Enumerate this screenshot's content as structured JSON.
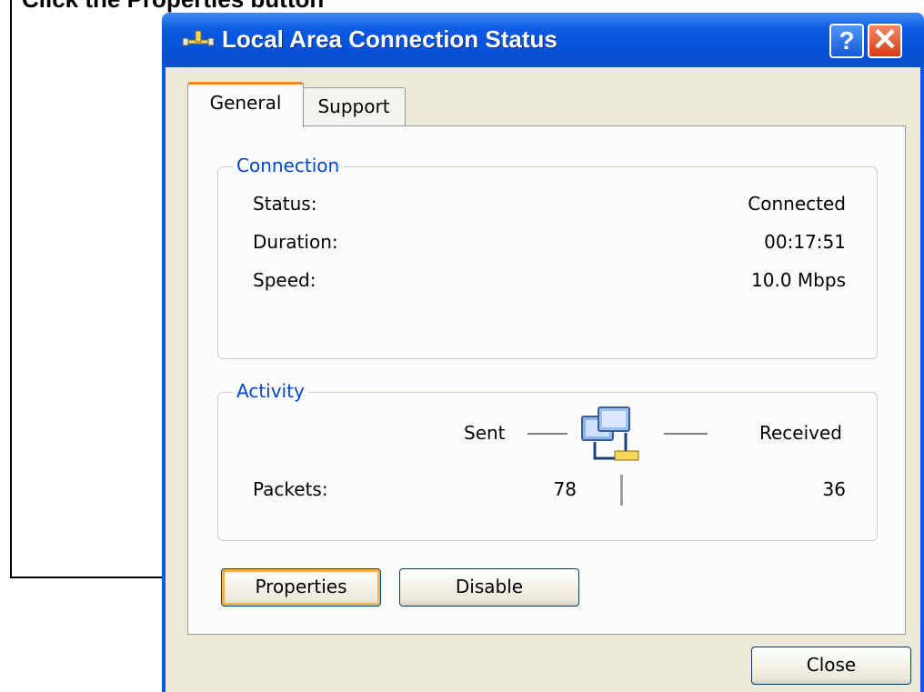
{
  "annotation": {
    "caption": "Click the Properties button"
  },
  "window": {
    "title": "Local Area Connection Status",
    "help_label": "?",
    "close_label": "✕"
  },
  "tabs": [
    {
      "label": "General"
    },
    {
      "label": "Support"
    }
  ],
  "connection": {
    "legend": "Connection",
    "rows": [
      {
        "label": "Status:",
        "value": "Connected"
      },
      {
        "label": "Duration:",
        "value": "00:17:51"
      },
      {
        "label": "Speed:",
        "value": "10.0 Mbps"
      }
    ]
  },
  "activity": {
    "legend": "Activity",
    "sent_label": "Sent",
    "received_label": "Received",
    "packets_label": "Packets:",
    "packets_sent": "78",
    "packets_received": "36"
  },
  "buttons": {
    "properties": "Properties",
    "disable": "Disable",
    "close": "Close"
  },
  "icons": {
    "title": "network-connection-icon",
    "activity": "network-computers-icon"
  },
  "colors": {
    "title_bar": "#0650d8",
    "group_legend": "#0046d5",
    "dialog_bg": "#ece9d8",
    "tab_highlight": "#e68b2c"
  }
}
